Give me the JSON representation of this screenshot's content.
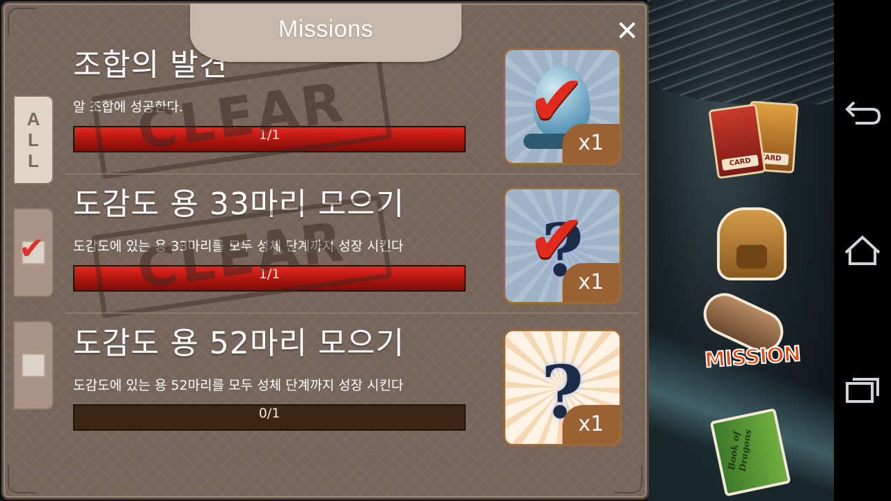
{
  "panel": {
    "title": "Missions",
    "close_label": "✕",
    "tabs": [
      {
        "label": "ALL",
        "selected": false
      },
      {
        "label": "",
        "checked": true
      },
      {
        "label": "",
        "checked": false
      }
    ]
  },
  "missions": [
    {
      "title": "조합의 발견",
      "description": "알 조합에 성공한다.",
      "progress_text": "1/1",
      "progress": 1.0,
      "stamp": "CLEAR",
      "reward_qty": "x1",
      "reward_icon": "egg-icon",
      "claimed": true
    },
    {
      "title": "도감도 용 33마리 모으기",
      "description": "도감도에 있는 용 33마리를 모두 성체 단계까지 성장 시킨다",
      "progress_text": "1/1",
      "progress": 1.0,
      "stamp": "CLEAR",
      "reward_qty": "x1",
      "reward_icon": "question-mark-icon",
      "claimed": true
    },
    {
      "title": "도감도 용 52마리 모으기",
      "description": "도감도에 있는 용 52마리를 모두 성체 단계까지 성장 시킨다",
      "progress_text": "0/1",
      "progress": 0.0,
      "stamp": "",
      "reward_qty": "x1",
      "reward_icon": "question-mark-icon",
      "claimed": false
    }
  ],
  "sidebar": {
    "card_label": "CARD",
    "mission_label": "MISSION",
    "book_label": "Book of Dragons"
  },
  "nav": {
    "back": "back-icon",
    "home": "home-icon",
    "recents": "recents-icon"
  },
  "colors": {
    "progress_red": "#e6261f",
    "panel_bg": "#76655b",
    "check_red": "#e22a1c"
  }
}
